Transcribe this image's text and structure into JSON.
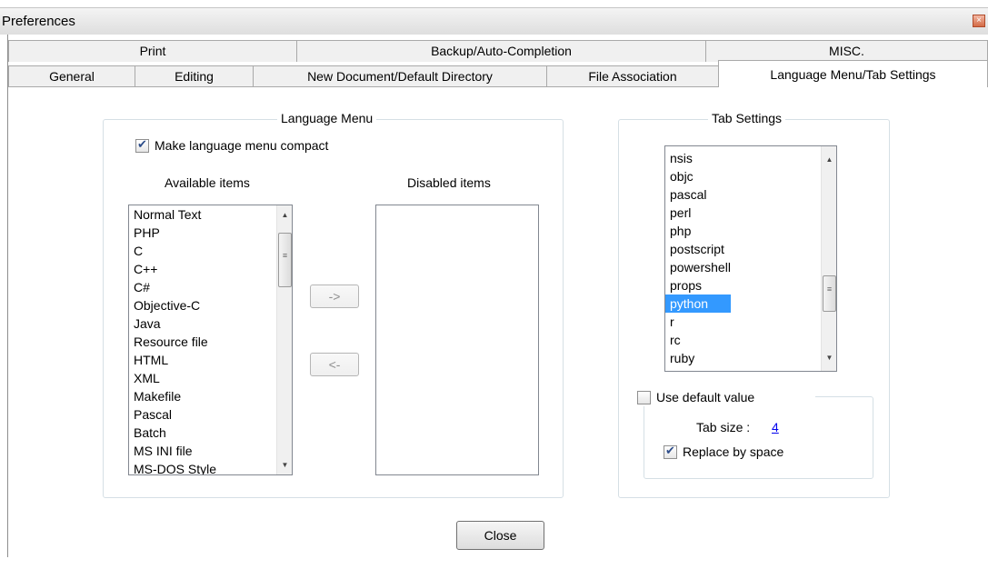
{
  "window": {
    "title": "Preferences",
    "close_glyph": "×"
  },
  "tabs": {
    "row1": [
      "Print",
      "Backup/Auto-Completion",
      "MISC."
    ],
    "row2": [
      "General",
      "Editing",
      "New Document/Default Directory",
      "File Association",
      "Language Menu/Tab Settings"
    ],
    "active": "Language Menu/Tab Settings"
  },
  "language_menu": {
    "title": "Language Menu",
    "compact_label": "Make language menu compact",
    "compact_checked": true,
    "available_header": "Available items",
    "disabled_header": "Disabled items",
    "available_items": [
      "Normal Text",
      "PHP",
      "C",
      "C++",
      "C#",
      "Objective-C",
      "Java",
      "Resource file",
      "HTML",
      "XML",
      "Makefile",
      "Pascal",
      "Batch",
      "MS INI file",
      "MS-DOS Style"
    ],
    "disabled_items": [],
    "move_right_label": "->",
    "move_left_label": "<-"
  },
  "tab_settings": {
    "title": "Tab Settings",
    "languages": [
      "nsis",
      "objc",
      "pascal",
      "perl",
      "php",
      "postscript",
      "powershell",
      "props",
      "python",
      "r",
      "rc",
      "ruby"
    ],
    "selected": "python",
    "use_default_label": "Use default value",
    "use_default_checked": false,
    "tab_size_label": "Tab size :",
    "tab_size_value": "4",
    "replace_label": "Replace by space",
    "replace_checked": true
  },
  "footer": {
    "close_label": "Close"
  },
  "icons": {
    "scroll_up": "▲",
    "scroll_down": "▼",
    "grip": "≡"
  }
}
